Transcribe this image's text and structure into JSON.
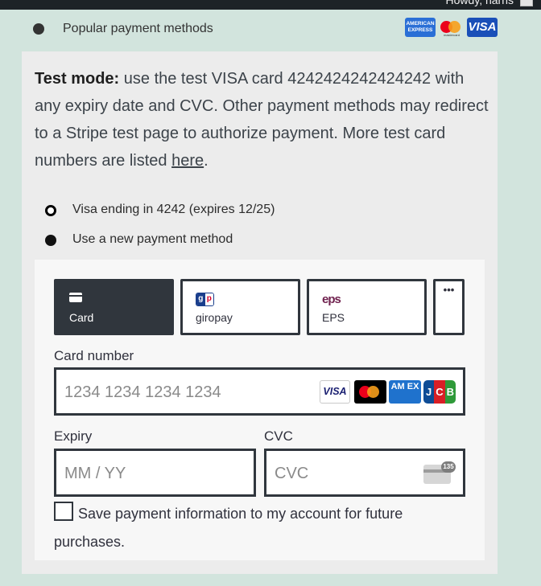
{
  "admin_bar": {
    "greeting": "Howdy, harris"
  },
  "payment_method": {
    "label": "Popular payment methods",
    "brand_icons": [
      "amex-icon",
      "mastercard-icon",
      "visa-icon"
    ],
    "amex_text": "AMERICAN EXPRESS",
    "mastercard_text": "mastercard",
    "visa_text": "VISA"
  },
  "test_mode": {
    "heading": "Test mode:",
    "text": "use the test VISA card 4242424242424242 with any expiry date and CVC. Other payment methods may redirect to a Stripe test page to authorize payment. More test card numbers are listed",
    "link_text": "here",
    "trailing": "."
  },
  "saved_methods": [
    {
      "label": "Visa ending in 4242 (expires 12/25)",
      "selected": false
    },
    {
      "label": "Use a new payment method",
      "selected": true
    }
  ],
  "tabs": [
    {
      "label": "Card",
      "icon": "card-icon",
      "active": true
    },
    {
      "label": "giropay",
      "icon": "giropay-icon",
      "active": false
    },
    {
      "label": "EPS",
      "icon": "eps-icon",
      "active": false
    },
    {
      "label": "•••",
      "icon": "more-icon",
      "active": false
    }
  ],
  "giropay_icon_text": {
    "g": "g",
    "p": "p"
  },
  "eps_icon_text": "eps",
  "card_form": {
    "card_number_label": "Card number",
    "card_number_placeholder": "1234 1234 1234 1234",
    "card_brand_icons": [
      "visa-icon",
      "mastercard-icon",
      "amex-icon",
      "jcb-icon"
    ],
    "visa_text": "VISA",
    "amex_text": "AM EX",
    "jcb_text": [
      "J",
      "C",
      "B"
    ],
    "expiry_label": "Expiry",
    "expiry_placeholder": "MM / YY",
    "cvc_label": "CVC",
    "cvc_placeholder": "CVC",
    "cvc_icon_number": "135"
  },
  "save_info": {
    "label": "Save payment information to my account for future purchases.",
    "checked": false
  },
  "colors": {
    "page_bg": "#d2e4dd",
    "panel_bg": "#ececec",
    "form_bg": "#f7f7f7",
    "active_tab": "#30363d"
  }
}
